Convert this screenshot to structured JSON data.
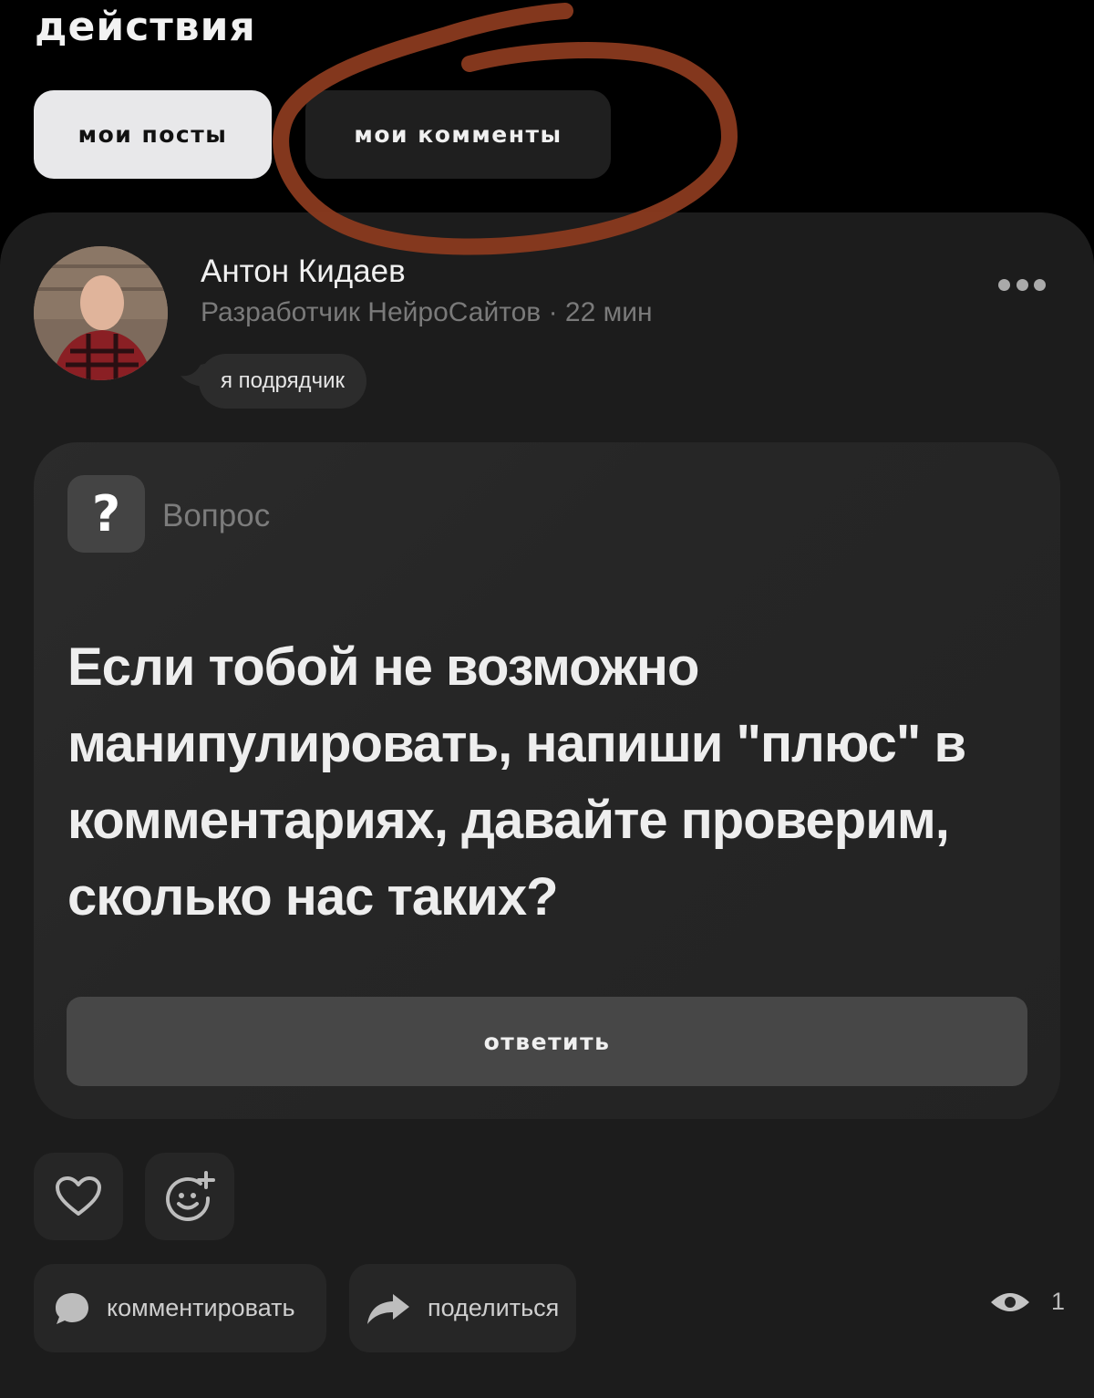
{
  "header": {
    "title": "действия"
  },
  "tabs": [
    {
      "label": "мои посты",
      "active": true
    },
    {
      "label": "мои комменты",
      "active": false
    }
  ],
  "annotation_color": "#8a3a1f",
  "post": {
    "author_name": "Антон Кидаев",
    "author_meta": "Разработчик НейроСайтов · 22 мин",
    "role_badge": "я подрядчик",
    "question": {
      "type_label": "Вопрос",
      "icon_glyph": "?",
      "text": "Если тобой не возможно манипулировать, напиши \"плюс\" в комментариях, давайте проверим, сколько нас таких?",
      "reply_label": "ответить"
    },
    "actions": {
      "comment_label": "комментировать",
      "share_label": "поделиться",
      "views_count": "1"
    }
  },
  "icons": [
    "more-dots-icon",
    "question-icon",
    "heart-icon",
    "add-reaction-icon",
    "comment-bubble-icon",
    "share-arrow-icon",
    "eye-icon"
  ]
}
